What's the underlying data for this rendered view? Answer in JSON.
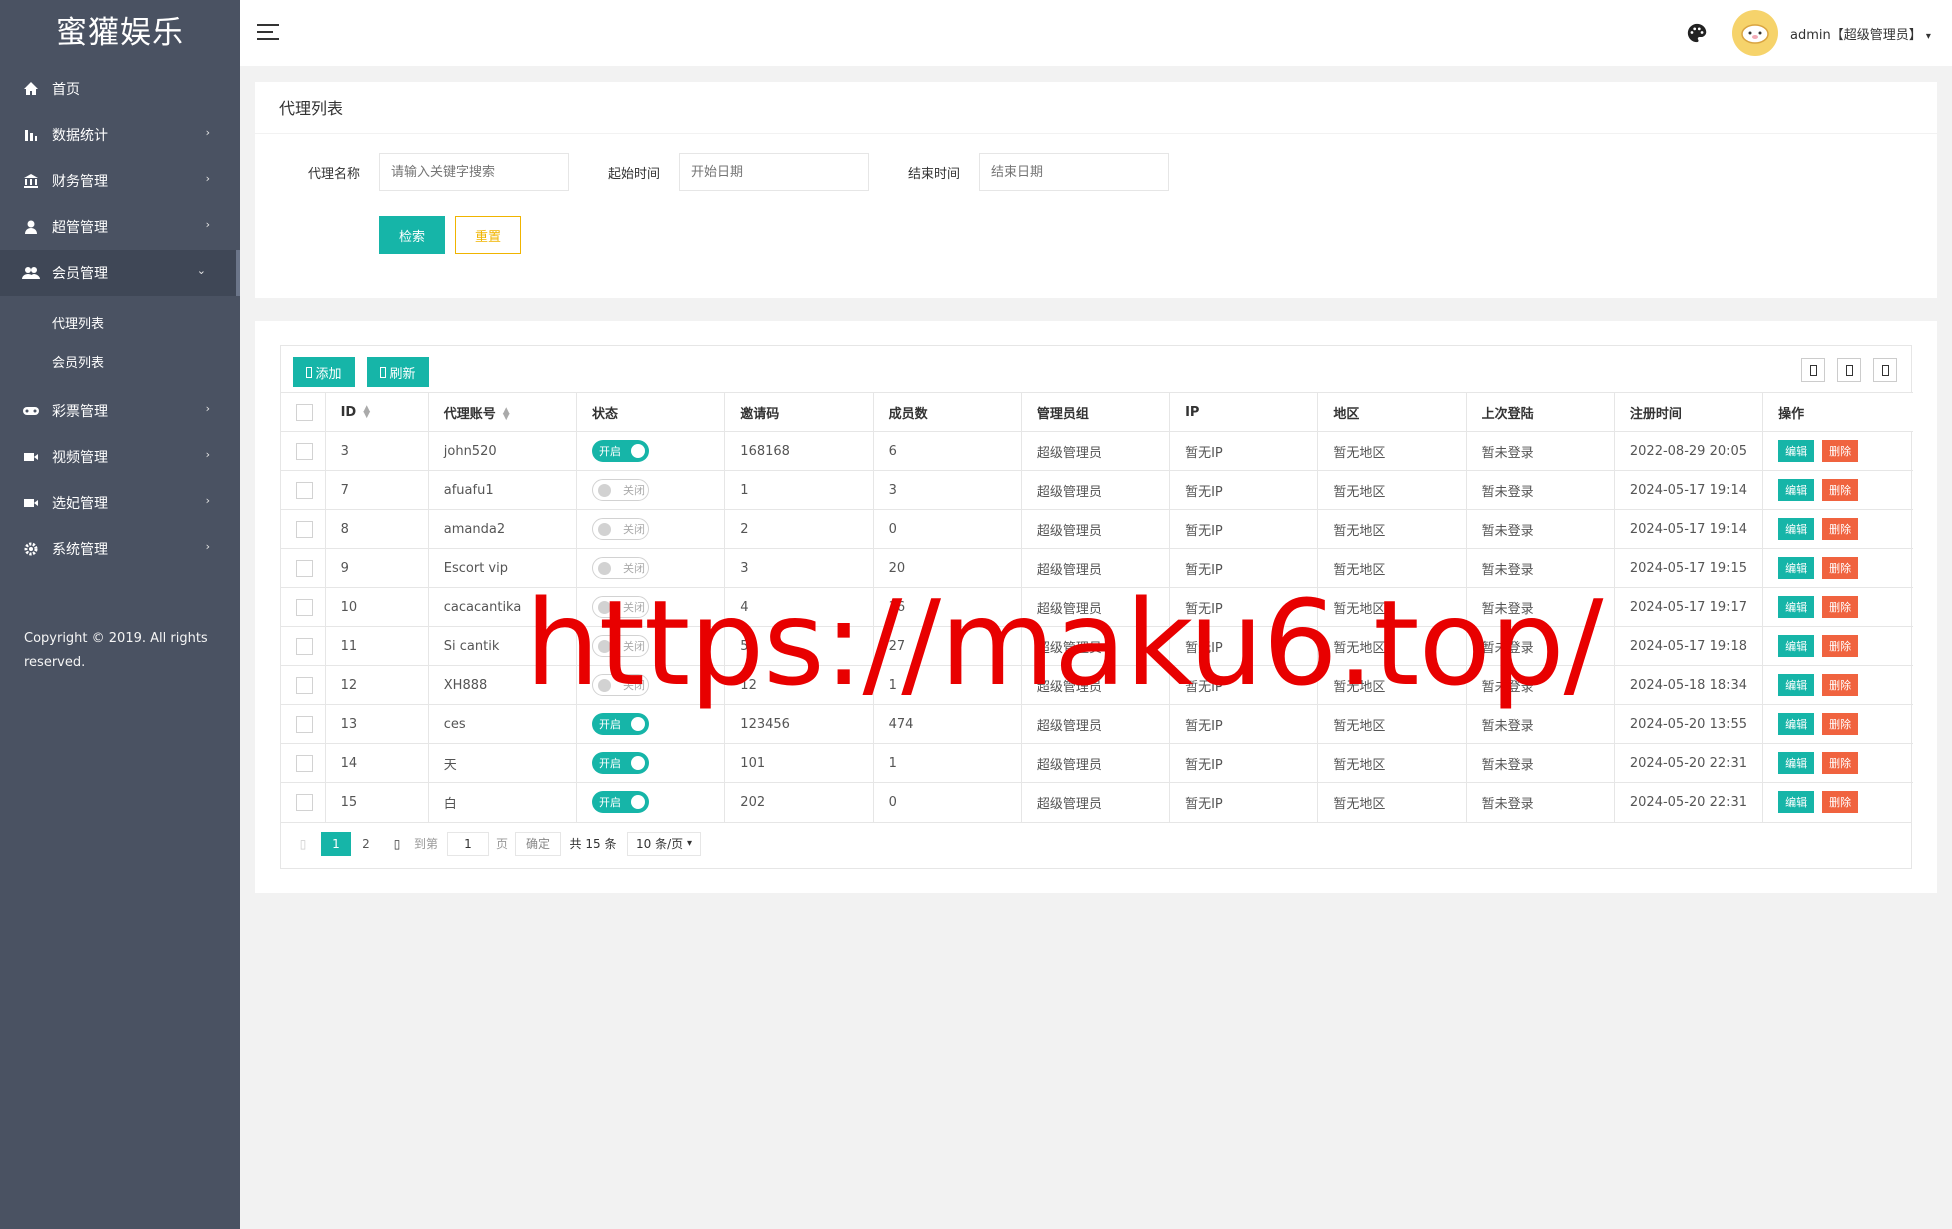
{
  "sidebar": {
    "logo": "蜜獾娱乐",
    "items": [
      {
        "label": "首页",
        "icon": "home-icon"
      },
      {
        "label": "数据统计",
        "icon": "bar-chart-icon"
      },
      {
        "label": "财务管理",
        "icon": "bank-icon"
      },
      {
        "label": "超管管理",
        "icon": "user-icon"
      },
      {
        "label": "会员管理",
        "icon": "users-icon"
      }
    ],
    "subitems": [
      {
        "label": "代理列表"
      },
      {
        "label": "会员列表"
      }
    ],
    "items2": [
      {
        "label": "彩票管理",
        "icon": "gamepad-icon"
      },
      {
        "label": "视频管理",
        "icon": "video-icon"
      },
      {
        "label": "选妃管理",
        "icon": "video-icon"
      },
      {
        "label": "系统管理",
        "icon": "gear-icon"
      }
    ],
    "copyright": "Copyright © 2019. All rights reserved."
  },
  "header": {
    "user": "admin【超级管理员】"
  },
  "search": {
    "title": "代理列表",
    "name_label": "代理名称",
    "name_placeholder": "请输入关键字搜索",
    "start_label": "起始时间",
    "start_placeholder": "开始日期",
    "end_label": "结束时间",
    "end_placeholder": "结束日期",
    "search_btn": "检索",
    "reset_btn": "重置"
  },
  "toolbar": {
    "add": "添加",
    "refresh": "刷新"
  },
  "table": {
    "headers": [
      "ID",
      "代理账号",
      "状态",
      "邀请码",
      "成员数",
      "管理员组",
      "IP",
      "地区",
      "上次登陆",
      "注册时间",
      "操作"
    ],
    "rows": [
      {
        "id": "3",
        "account": "john520",
        "status": "开启",
        "on": true,
        "code": "168168",
        "members": "6",
        "group": "超级管理员",
        "ip": "暂无IP",
        "region": "暂无地区",
        "last": "暂未登录",
        "reg": "2022-08-29 20:05"
      },
      {
        "id": "7",
        "account": "afuafu1",
        "status": "关闭",
        "on": false,
        "code": "1",
        "members": "3",
        "group": "超级管理员",
        "ip": "暂无IP",
        "region": "暂无地区",
        "last": "暂未登录",
        "reg": "2024-05-17 19:14"
      },
      {
        "id": "8",
        "account": "amanda2",
        "status": "关闭",
        "on": false,
        "code": "2",
        "members": "0",
        "group": "超级管理员",
        "ip": "暂无IP",
        "region": "暂无地区",
        "last": "暂未登录",
        "reg": "2024-05-17 19:14"
      },
      {
        "id": "9",
        "account": "Escort vip",
        "status": "关闭",
        "on": false,
        "code": "3",
        "members": "20",
        "group": "超级管理员",
        "ip": "暂无IP",
        "region": "暂无地区",
        "last": "暂未登录",
        "reg": "2024-05-17 19:15"
      },
      {
        "id": "10",
        "account": "cacacantika",
        "status": "关闭",
        "on": false,
        "code": "4",
        "members": "36",
        "group": "超级管理员",
        "ip": "暂无IP",
        "region": "暂无地区",
        "last": "暂未登录",
        "reg": "2024-05-17 19:17"
      },
      {
        "id": "11",
        "account": "Si cantik",
        "status": "关闭",
        "on": false,
        "code": "5",
        "members": "27",
        "group": "超级管理员",
        "ip": "暂无IP",
        "region": "暂无地区",
        "last": "暂未登录",
        "reg": "2024-05-17 19:18"
      },
      {
        "id": "12",
        "account": "XH888",
        "status": "关闭",
        "on": false,
        "code": "12",
        "members": "1",
        "group": "超级管理员",
        "ip": "暂无IP",
        "region": "暂无地区",
        "last": "暂未登录",
        "reg": "2024-05-18 18:34"
      },
      {
        "id": "13",
        "account": "ces",
        "status": "开启",
        "on": true,
        "code": "123456",
        "members": "474",
        "group": "超级管理员",
        "ip": "暂无IP",
        "region": "暂无地区",
        "last": "暂未登录",
        "reg": "2024-05-20 13:55"
      },
      {
        "id": "14",
        "account": "天",
        "status": "开启",
        "on": true,
        "code": "101",
        "members": "1",
        "group": "超级管理员",
        "ip": "暂无IP",
        "region": "暂无地区",
        "last": "暂未登录",
        "reg": "2024-05-20 22:31"
      },
      {
        "id": "15",
        "account": "白",
        "status": "开启",
        "on": true,
        "code": "202",
        "members": "0",
        "group": "超级管理员",
        "ip": "暂无IP",
        "region": "暂无地区",
        "last": "暂未登录",
        "reg": "2024-05-20 22:31"
      }
    ],
    "edit": "编辑",
    "delete": "删除"
  },
  "pager": {
    "current": "1",
    "next": "2",
    "goto": "到第",
    "page_value": "1",
    "page_unit": "页",
    "confirm": "确定",
    "total": "共 15 条",
    "per_page": "10 条/页"
  },
  "watermark": "https://maku6.top/"
}
